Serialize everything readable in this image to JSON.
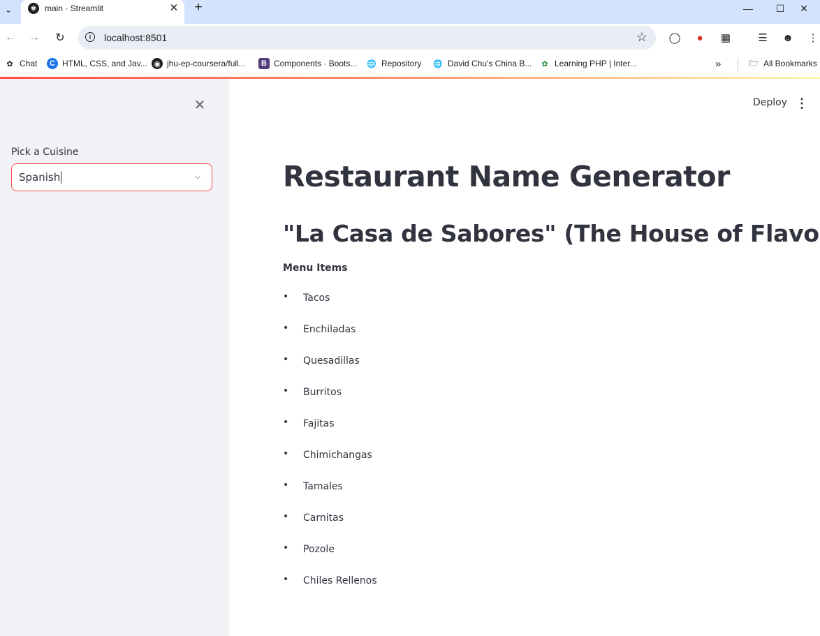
{
  "browser": {
    "tab_title": "main · Streamlit",
    "url": "localhost:8501",
    "bookmarks": [
      {
        "label": "Chat"
      },
      {
        "label": "HTML, CSS, and Jav..."
      },
      {
        "label": "jhu-ep-coursera/full..."
      },
      {
        "label": "Components · Boots..."
      },
      {
        "label": "Repository"
      },
      {
        "label": "David Chu's China B..."
      },
      {
        "label": "Learning PHP | Inter..."
      }
    ],
    "all_bookmarks_label": "All Bookmarks"
  },
  "sidebar": {
    "select_label": "Pick a Cuisine",
    "select_value": "Spanish"
  },
  "header": {
    "deploy_label": "Deploy"
  },
  "main": {
    "title": "Restaurant Name Generator",
    "restaurant_name": "\"La Casa de Sabores\" (The House of Flavors)",
    "menu_heading": "Menu Items",
    "menu_items": [
      "Tacos",
      "Enchiladas",
      "Quesadillas",
      "Burritos",
      "Fajitas",
      "Chimichangas",
      "Tamales",
      "Carnitas",
      "Pozole",
      "Chiles Rellenos"
    ]
  },
  "colors": {
    "accent": "#ff4b4b",
    "sidebar_bg": "#f0f2f6",
    "text": "#31333f",
    "tabbar_bg": "#d3e3fd"
  }
}
